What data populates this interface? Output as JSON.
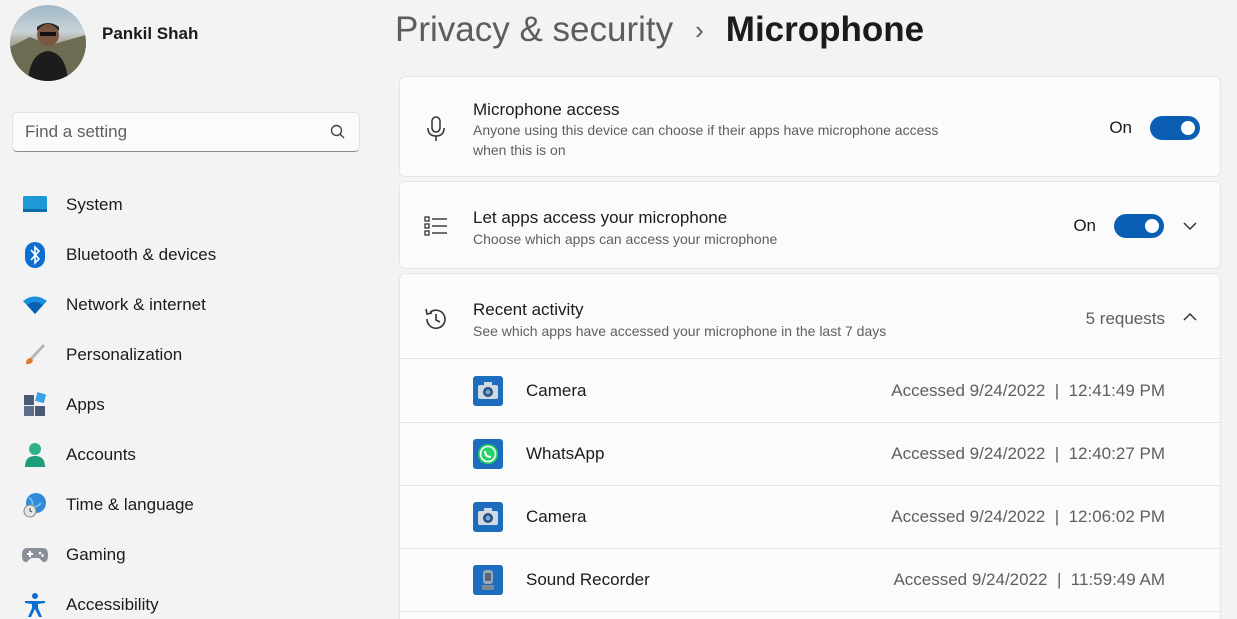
{
  "profile": {
    "name": "Pankil Shah"
  },
  "search": {
    "placeholder": "Find a setting"
  },
  "nav": [
    {
      "label": "System",
      "icon": "system-icon"
    },
    {
      "label": "Bluetooth & devices",
      "icon": "bluetooth-icon"
    },
    {
      "label": "Network & internet",
      "icon": "wifi-icon"
    },
    {
      "label": "Personalization",
      "icon": "brush-icon"
    },
    {
      "label": "Apps",
      "icon": "apps-icon"
    },
    {
      "label": "Accounts",
      "icon": "person-icon"
    },
    {
      "label": "Time & language",
      "icon": "globe-clock-icon"
    },
    {
      "label": "Gaming",
      "icon": "gamepad-icon"
    },
    {
      "label": "Accessibility",
      "icon": "accessibility-icon"
    }
  ],
  "breadcrumb": {
    "parent": "Privacy & security",
    "separator": "›",
    "current": "Microphone"
  },
  "mic_access": {
    "title": "Microphone access",
    "desc_line1": "Anyone using this device can choose if their apps have microphone access",
    "desc_line2": "when this is on",
    "state": "On"
  },
  "app_access": {
    "title": "Let apps access your microphone",
    "desc": "Choose which apps can access your microphone",
    "state": "On"
  },
  "recent": {
    "title": "Recent activity",
    "desc": "See which apps have accessed your microphone in the last 7 days",
    "count": "5 requests",
    "items": [
      {
        "name": "Camera",
        "time": "Accessed 9/24/2022  |  12:41:49 PM",
        "icon": "camera-icon"
      },
      {
        "name": "WhatsApp",
        "time": "Accessed 9/24/2022  |  12:40:27 PM",
        "icon": "whatsapp-icon"
      },
      {
        "name": "Camera",
        "time": "Accessed 9/24/2022  |  12:06:02 PM",
        "icon": "camera-icon"
      },
      {
        "name": "Sound Recorder",
        "time": "Accessed 9/24/2022  |  11:59:49 AM",
        "icon": "sound-recorder-icon"
      }
    ]
  },
  "colors": {
    "accent": "#0a5fb4",
    "background": "#f3f3f3",
    "card": "#fbfbfb"
  }
}
